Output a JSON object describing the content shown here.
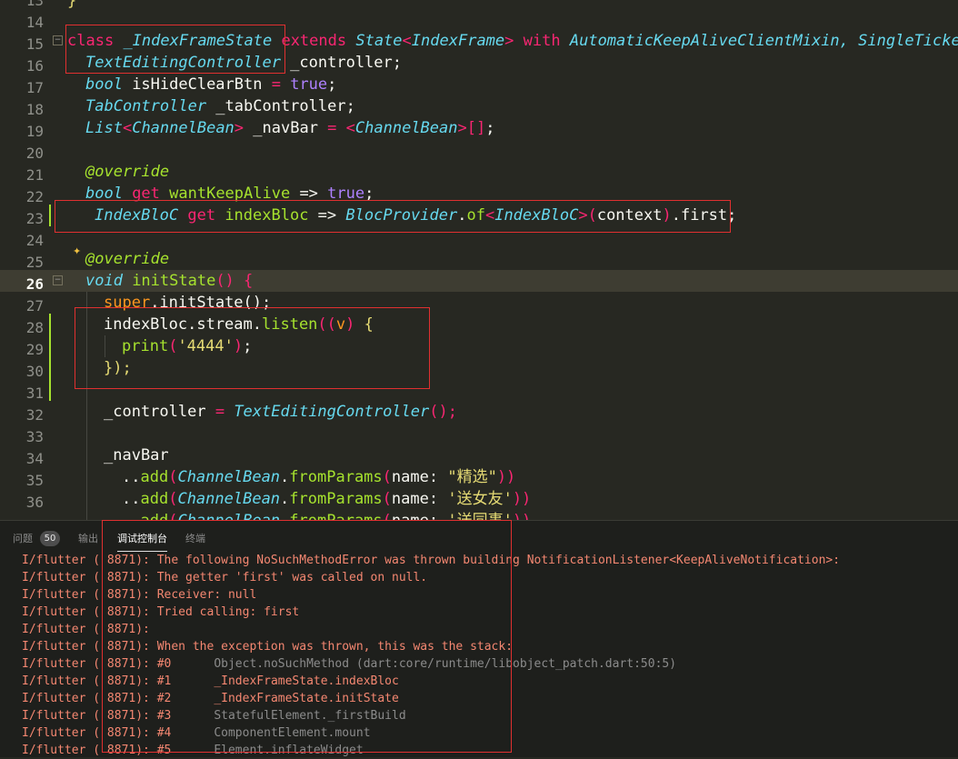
{
  "editor": {
    "line_numbers": [
      "13",
      "14",
      "15",
      "16",
      "17",
      "18",
      "19",
      "20",
      "21",
      "22",
      "23",
      "24",
      "25",
      "26",
      "27",
      "28",
      "29",
      "30",
      "31",
      "32",
      "33",
      "34",
      "35",
      "36"
    ],
    "active_line": "26",
    "code": {
      "l13": "}",
      "l15": {
        "class_kw": "class",
        "class_name": "_IndexFrameState",
        "extends_kw": "extends",
        "state": "State",
        "lt": "<",
        "index_frame": "IndexFrame",
        "gt": ">",
        "with_kw": "with",
        "mixin1": "AutomaticKeepAliveClientMixin,",
        "mixin2": "SingleTickerPr"
      },
      "l16": {
        "type": "TextEditingController",
        "rest": " _controller;"
      },
      "l17": {
        "type": "bool",
        "name": " isHideClearBtn ",
        "eq": "=",
        "val": " true",
        "semi": ";"
      },
      "l18": {
        "type": "TabController",
        "rest": " _tabController;"
      },
      "l19": {
        "list": "List",
        "lt": "<",
        "bean": "ChannelBean",
        "gt": ">",
        "name": " _navBar ",
        "eq": "=",
        "lt2": " <",
        "bean2": "ChannelBean",
        "gt2": ">",
        "brackets": "[]",
        "semi": ";"
      },
      "l21": "@override",
      "l22": {
        "type": "bool",
        "get": " get",
        "name": " wantKeepAlive",
        "arrow": " =>",
        "val": " true",
        "semi": ";"
      },
      "l23": {
        "type": "IndexBloC",
        "get": " get",
        "name": " indexBloc",
        "arrow": " =>",
        "provider": " BlocProvider",
        "dot": ".",
        "of": "of",
        "lt": "<",
        "type2": "IndexBloC",
        "gt": ">",
        "lp": "(",
        "ctx": "context",
        "rp": ")",
        "rest": ".first;"
      },
      "l25": "@override",
      "l26": {
        "void": "void",
        "name": " initState",
        "parens": "()",
        "brace": " {"
      },
      "l27": {
        "super": "super",
        "rest": ".initState();"
      },
      "l28": {
        "obj": "indexBloc.stream.",
        "listen": "listen",
        "open": "((",
        "v": "v",
        "close": ")",
        "brace": " {"
      },
      "l29": {
        "print": "print",
        "lp": "(",
        "str": "'4444'",
        "rp": ")",
        "semi": ";"
      },
      "l30": "});",
      "l32": {
        "name": "_controller ",
        "eq": "=",
        "type": " TextEditingController",
        "rest": "();"
      },
      "l34": "_navBar",
      "l35": {
        "dots": "..",
        "add": "add",
        "lp": "(",
        "bean": "ChannelBean",
        "dot": ".",
        "from": "fromParams",
        "lp2": "(",
        "name": "name:",
        "str": " \"精选\"",
        "rp": "))"
      },
      "l36": {
        "dots": "..",
        "add": "add",
        "lp": "(",
        "bean": "ChannelBean",
        "dot": ".",
        "from": "fromParams",
        "lp2": "(",
        "name": "name:",
        "str": " '送女友'",
        "rp": "))"
      },
      "l37": {
        "dots": "..",
        "add": "add",
        "lp": "(",
        "bean": "ChannelBean",
        "dot": ".",
        "from": "fromParams",
        "lp2": "(",
        "name": "name:",
        "str": " '送同事'",
        "rp": "))"
      }
    }
  },
  "panel": {
    "tabs": [
      {
        "label": "问题"
      },
      {
        "label": "输出"
      },
      {
        "label": "调试控制台"
      },
      {
        "label": "终端"
      }
    ],
    "problems_count": "50",
    "active_tab": "调试控制台",
    "log": [
      {
        "text": "I/flutter ( 8871): The following NoSuchMethodError was thrown building NotificationListener<KeepAliveNotification>:",
        "kind": "red"
      },
      {
        "text": "I/flutter ( 8871): The getter 'first' was called on null.",
        "kind": "red"
      },
      {
        "text": "I/flutter ( 8871): Receiver: null",
        "kind": "red"
      },
      {
        "text": "I/flutter ( 8871): Tried calling: first",
        "kind": "red"
      },
      {
        "text": "I/flutter ( 8871):",
        "kind": "red"
      },
      {
        "text": "I/flutter ( 8871): When the exception was thrown, this was the stack:",
        "kind": "red"
      },
      {
        "text": "I/flutter ( 8871): #0      ",
        "rest": "Object.noSuchMethod (dart:core/runtime/libobject_patch.dart:50:5)",
        "kind": "red-gray"
      },
      {
        "text": "I/flutter ( 8871): #1      ",
        "rest": "_IndexFrameState.indexBloc",
        "kind": "red-red"
      },
      {
        "text": "I/flutter ( 8871): #2      ",
        "rest": "_IndexFrameState.initState",
        "kind": "red-red"
      },
      {
        "text": "I/flutter ( 8871): #3      ",
        "rest": "StatefulElement._firstBuild",
        "kind": "red-gray"
      },
      {
        "text": "I/flutter ( 8871): #4      ",
        "rest": "ComponentElement.mount",
        "kind": "red-gray"
      },
      {
        "text": "I/flutter ( 8871): #5      ",
        "rest": "Element.inflateWidget",
        "kind": "red-gray"
      }
    ]
  },
  "colors": {
    "editor_bg": "#272822",
    "panel_bg": "#1e1f1c",
    "error_text": "#f48771",
    "highlight_box": "#e03030"
  }
}
